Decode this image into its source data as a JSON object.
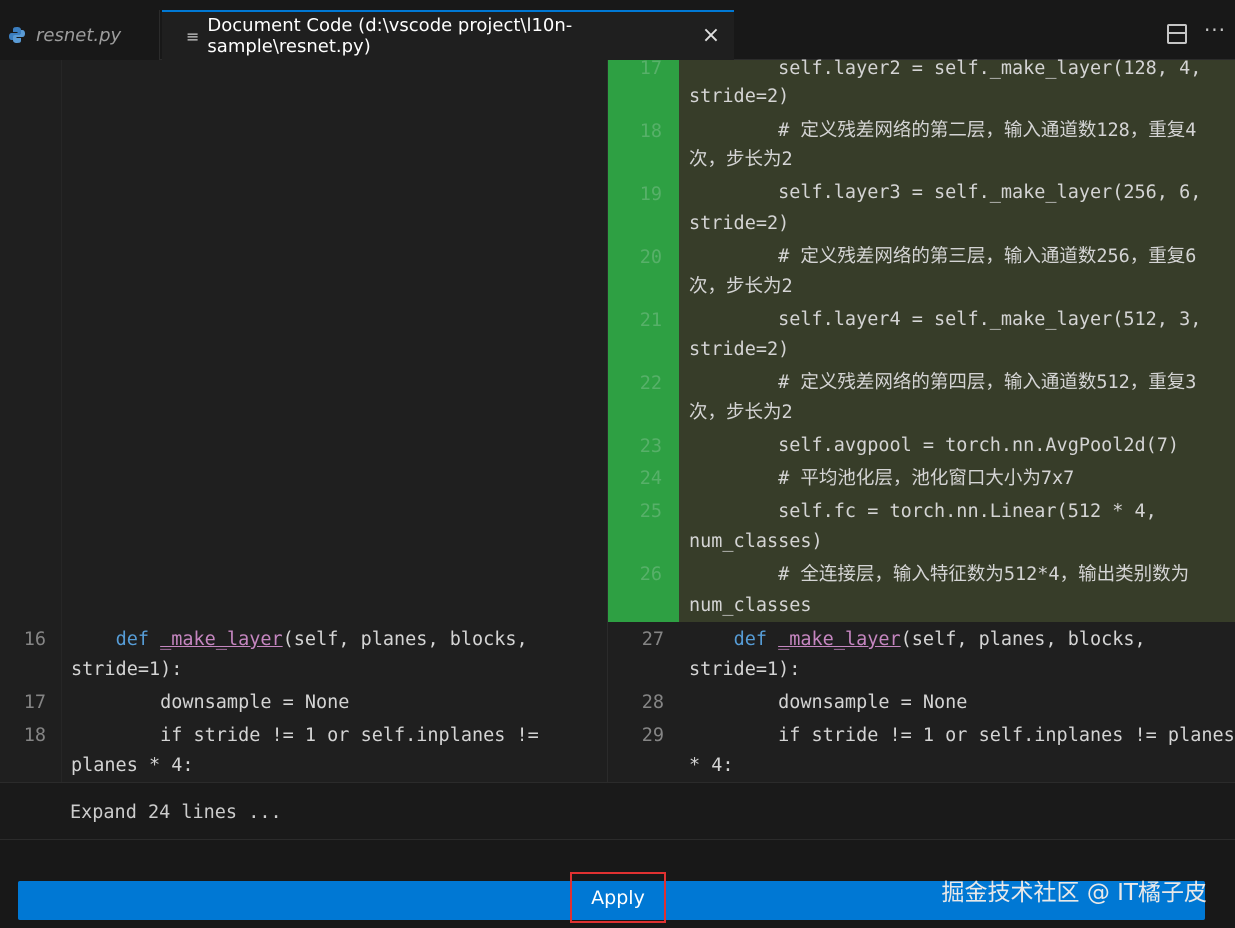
{
  "tabs": [
    {
      "label": "resnet.py",
      "icon": "python-icon",
      "active": false
    },
    {
      "label": "Document Code (d:\\vscode project\\l10n-sample\\resnet.py)",
      "icon": "document-icon",
      "active": true
    }
  ],
  "editor_actions": {
    "split_icon": "split-editor-icon",
    "more_icon": "more-actions-icon"
  },
  "inserted_block": {
    "line_numbers": [
      "17",
      "18",
      "19",
      "20",
      "21",
      "22",
      "23",
      "24",
      "25",
      "26"
    ],
    "lines": [
      "        self.layer2 = self._make_layer(128, 4,",
      "stride=2)",
      "        # 定义残差网络的第二层，输入通道数128，重复4",
      "次，步长为2",
      "        self.layer3 = self._make_layer(256, 6,",
      "stride=2)",
      "        # 定义残差网络的第三层，输入通道数256，重复6",
      "次，步长为2",
      "        self.layer4 = self._make_layer(512, 3,",
      "stride=2)",
      "        # 定义残差网络的第四层，输入通道数512，重复3",
      "次，步长为2",
      "        self.avgpool = torch.nn.AvgPool2d(7)",
      "        # 平均池化层，池化窗口大小为7x7",
      "        self.fc = torch.nn.Linear(512 * 4,",
      "num_classes)",
      "        # 全连接层，输入特征数为512*4，输出类别数为",
      "num_classes"
    ]
  },
  "left_pane": {
    "line_numbers": [
      "16",
      "17",
      "18"
    ],
    "def_indent": "    ",
    "def_kw": "def",
    "def_fn": "_make_layer",
    "def_rest": "(self, planes, blocks,",
    "def_cont": "stride=1):",
    "downsample": "        downsample = None",
    "if_line": "        if stride != 1 or self.inplanes !=",
    "if_cont": "planes * 4:"
  },
  "right_pane": {
    "line_numbers": [
      "27",
      "28",
      "29"
    ],
    "def_indent": "    ",
    "def_kw": "def",
    "def_fn": "_make_layer",
    "def_rest": "(self, planes, blocks,",
    "def_cont": "stride=1):",
    "downsample": "        downsample = None",
    "if_line": "        if stride != 1 or self.inplanes != planes",
    "if_cont": "* 4:"
  },
  "expand": {
    "label": "Expand 24 lines ..."
  },
  "apply": {
    "label": "Apply",
    "color": "#0078d4",
    "highlight_color": "#e03131"
  },
  "watermark": "掘金技术社区 @ IT橘子皮"
}
